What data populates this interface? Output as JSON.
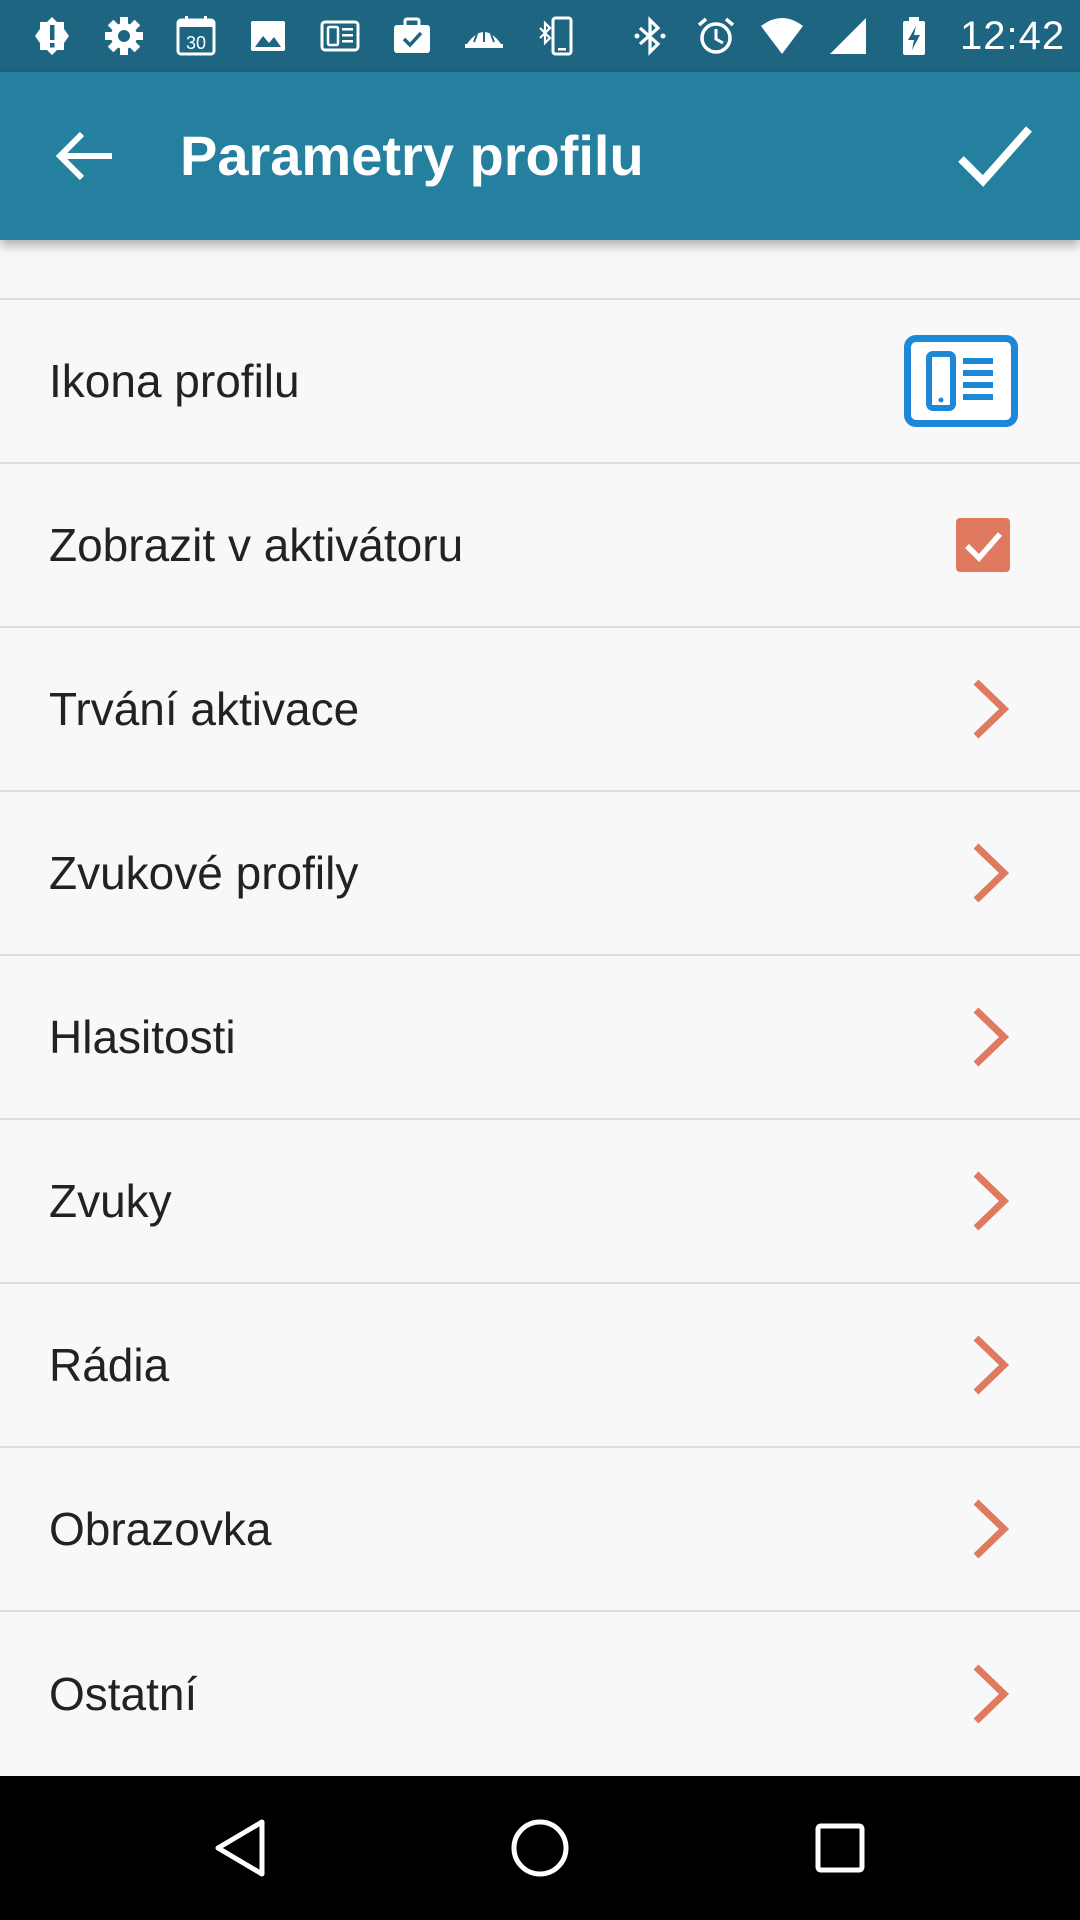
{
  "status_bar": {
    "time": "12:42",
    "calendar_day": "30",
    "left_icons": [
      "alert-icon",
      "settings-icon",
      "calendar-icon",
      "image-icon",
      "profile-card-icon",
      "briefcase-check-icon",
      "dome-icon",
      "phone-bluetooth-icon"
    ],
    "right_icons": [
      "bluetooth-icon",
      "alarm-icon",
      "wifi-icon",
      "signal-icon",
      "battery-charging-icon"
    ]
  },
  "app_bar": {
    "title": "Parametry profilu",
    "back_icon": "arrow-back-icon",
    "confirm_icon": "check-icon",
    "color": "#25809f"
  },
  "list": {
    "items": [
      {
        "label": "Ikona profilu",
        "trailing": "profile-icon"
      },
      {
        "label": "Zobrazit v aktivátoru",
        "trailing": "checkbox",
        "checked": true
      },
      {
        "label": "Trvání aktivace",
        "trailing": "chevron"
      },
      {
        "label": "Zvukové profily",
        "trailing": "chevron"
      },
      {
        "label": "Hlasitosti",
        "trailing": "chevron"
      },
      {
        "label": "Zvuky",
        "trailing": "chevron"
      },
      {
        "label": "Rádia",
        "trailing": "chevron"
      },
      {
        "label": "Obrazovka",
        "trailing": "chevron"
      },
      {
        "label": "Ostatní",
        "trailing": "chevron"
      }
    ]
  },
  "nav_bar": {
    "icons": [
      "back-triangle-icon",
      "home-circle-icon",
      "recents-square-icon"
    ]
  },
  "colors": {
    "status_bar": "#1d6580",
    "accent": "#e07a5f",
    "profile_icon": "#1e88d8"
  }
}
